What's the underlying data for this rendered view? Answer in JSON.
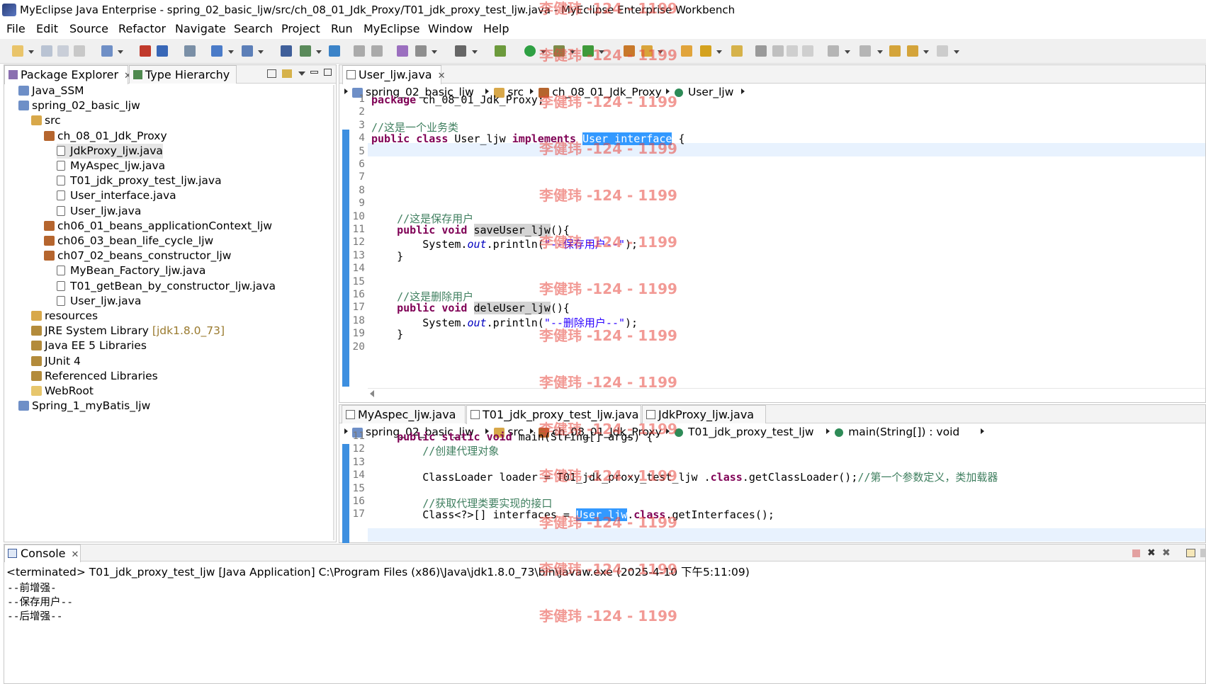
{
  "window": {
    "title": "MyEclipse Java Enterprise - spring_02_basic_ljw/src/ch_08_01_Jdk_Proxy/T01_jdk_proxy_test_ljw.java - MyEclipse Enterprise Workbench"
  },
  "menu": [
    "File",
    "Edit",
    "Source",
    "Refactor",
    "Navigate",
    "Search",
    "Project",
    "Run",
    "MyEclipse",
    "Window",
    "Help"
  ],
  "left_panel": {
    "tabs": [
      {
        "label": "Package Explorer",
        "active": true
      },
      {
        "label": "Type Hierarchy",
        "active": false
      }
    ],
    "tree": [
      {
        "label": "Java_SSM",
        "depth": 0,
        "icon": "project-icon"
      },
      {
        "label": "spring_02_basic_ljw",
        "depth": 0,
        "icon": "project-icon"
      },
      {
        "label": "src",
        "depth": 1,
        "icon": "source-folder-icon"
      },
      {
        "label": "ch_08_01_Jdk_Proxy",
        "depth": 2,
        "icon": "package-icon"
      },
      {
        "label": "JdkProxy_ljw.java",
        "depth": 3,
        "icon": "java-file-icon",
        "selected": true
      },
      {
        "label": "MyAspec_ljw.java",
        "depth": 3,
        "icon": "java-file-icon"
      },
      {
        "label": "T01_jdk_proxy_test_ljw.java",
        "depth": 3,
        "icon": "java-file-icon"
      },
      {
        "label": "User_interface.java",
        "depth": 3,
        "icon": "java-file-icon"
      },
      {
        "label": "User_ljw.java",
        "depth": 3,
        "icon": "java-file-icon"
      },
      {
        "label": "ch06_01_beans_applicationContext_ljw",
        "depth": 2,
        "icon": "package-icon"
      },
      {
        "label": "ch06_03_bean_life_cycle_ljw",
        "depth": 2,
        "icon": "package-icon"
      },
      {
        "label": "ch07_02_beans_constructor_ljw",
        "depth": 2,
        "icon": "package-icon"
      },
      {
        "label": "MyBean_Factory_ljw.java",
        "depth": 3,
        "icon": "java-file-icon"
      },
      {
        "label": "T01_getBean_by_constructor_ljw.java",
        "depth": 3,
        "icon": "java-file-icon"
      },
      {
        "label": "User_ljw.java",
        "depth": 3,
        "icon": "java-file-icon"
      },
      {
        "label": "resources",
        "depth": 1,
        "icon": "source-folder-icon"
      },
      {
        "label": "JRE System Library",
        "version": "[jdk1.8.0_73]",
        "depth": 1,
        "icon": "library-icon"
      },
      {
        "label": "Java EE 5 Libraries",
        "depth": 1,
        "icon": "library-icon"
      },
      {
        "label": "JUnit 4",
        "depth": 1,
        "icon": "library-icon"
      },
      {
        "label": "Referenced Libraries",
        "depth": 1,
        "icon": "library-icon"
      },
      {
        "label": "WebRoot",
        "depth": 1,
        "icon": "folder-icon"
      },
      {
        "label": "Spring_1_myBatis_ljw",
        "depth": 0,
        "icon": "project-icon"
      }
    ]
  },
  "editor_top": {
    "tab": "User_ljw.java",
    "breadcrumb": [
      "spring_02_basic_ljw",
      "src",
      "ch_08_01_Jdk_Proxy",
      "User_ljw"
    ],
    "line_numbers": [
      "1",
      "2",
      "3",
      "4",
      "5",
      "6",
      "7",
      "8",
      "9",
      "10",
      "11",
      "12",
      "13",
      "14",
      "15",
      "16",
      "17",
      "18",
      "19",
      "20"
    ],
    "lines": [
      "package ch_08_01_Jdk_Proxy;",
      "",
      "//这是一个业务类",
      "public class User_ljw implements User_interface {",
      "",
      "",
      "",
      "",
      "",
      "    //这是保存用户",
      "    public void saveUser_ljw(){",
      "        System.out.println(\"--保存用户--\");",
      "    }",
      "",
      "",
      "    //这是删除用户",
      "    public void deleUser_ljw(){",
      "        System.out.println(\"--删除用户--\");",
      "    }",
      ""
    ]
  },
  "editor_bottom": {
    "tabs": [
      {
        "label": "MyAspec_ljw.java",
        "active": false
      },
      {
        "label": "T01_jdk_proxy_test_ljw.java",
        "active": true
      },
      {
        "label": "JdkProxy_ljw.java",
        "active": false
      }
    ],
    "breadcrumb": [
      "spring_02_basic_ljw",
      "src",
      "ch_08_01_Jdk_Proxy",
      "T01_jdk_proxy_test_ljw",
      "main(String[]) : void"
    ],
    "line_numbers": [
      "11",
      "12",
      "13",
      "14",
      "15",
      "16",
      "17"
    ],
    "lines": [
      "    public static void main(String[] args) {",
      "        //创建代理对象",
      "",
      "        ClassLoader loader = T01_jdk_proxy_test_ljw .class.getClassLoader();//第一个参数定义，类加载器",
      "",
      "        //获取代理类要实现的接口",
      "        Class<?>[] interfaces = User_ljw.class.getInterfaces();"
    ]
  },
  "console": {
    "tab": "Console",
    "header": "<terminated> T01_jdk_proxy_test_ljw [Java Application] C:\\Program Files (x86)\\Java\\jdk1.8.0_73\\bin\\javaw.exe (2025-4-10 下午5:11:09)",
    "output": [
      "--前增强-",
      "--保存用户--",
      "--后增强--"
    ]
  },
  "watermark": "李健玮 -124 - 1199",
  "colors": {
    "keyword": "#7f0055",
    "comment": "#3f7f5f",
    "string": "#2a00ff",
    "selection": "#3399ff",
    "watermark": "#e8483f"
  }
}
